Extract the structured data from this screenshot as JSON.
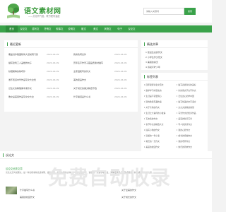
{
  "header": {
    "site_name": "语文素材网",
    "slogan": "——文化有气度，教书更有温度",
    "search_placeholder": "请输入关键词",
    "search_button": "搜索"
  },
  "nav": {
    "items": [
      "首页",
      "议论文",
      "描写文",
      "抒情文",
      "叙事文",
      "说明文",
      "散文",
      "美文",
      "状物文",
      "句子",
      "议论文"
    ]
  },
  "latest": {
    "title": "最近更新",
    "rows": [
      {
        "title": "覆盖创作路面移情大道前雨习篇",
        "date": "2024-04-09",
        "title2": "我喜欢荷念作",
        "date2": "2024-04-09"
      },
      {
        "title": "描写建筑工人盖楼的句子",
        "date": "2024-04-09",
        "title2": "历年名字作景子藏品费素材描写",
        "date2": "2024-04-09"
      },
      {
        "title": "秋晒美等的物呀作",
        "date": "2024-04-09",
        "title2": "全家温暖写的作文",
        "date2": "2024-04-09"
      },
      {
        "title": "谁不知道中华作品写文大全优",
        "date": "2024-04-09",
        "title2": "美的卖品作文",
        "date2": "2024-04-09"
      },
      {
        "title": "记住文的精髓美丰素作文",
        "date": "2024-04-09",
        "title2": "关于成长的美文精选节选",
        "date2": "2024-04-09"
      },
      {
        "title": "散文是美丽作品写文文大全",
        "date": "2024-04-09",
        "title2": "什字播话是什么书",
        "date2": "2024-04-09"
      }
    ]
  },
  "featured": {
    "title": "精选文章",
    "rows": [
      "1 建设生态的作文",
      "2 小学生作文范文",
      "3 美丽的春天",
      "4 诉说叮咛少年"
    ]
  },
  "tags": {
    "title": "标签列表",
    "items": [
      "四年级游泳表文范文",
      "描写春夏秋冬的美好",
      "数学学习好朋友的",
      "好的用文字文字作文",
      "生活是不需要用心",
      "记住这心的学中国",
      "别的教我有趣的事",
      "描写优美的文字语言",
      "关于亲情的作文",
      "文言文说教的美丽",
      "生活之大事件的小故事",
      "写景作文的优秀作品",
      "写友情的作文",
      "美丽的秋天写景",
      "春节作文的精选大全",
      "写人的优秀作文",
      "描写小狗的作文",
      "我的心愿作文",
      "温暖的一件小事",
      "成长的烦恼作文",
      "难忘的一天作文",
      "我的老师作文",
      "美丽的校园作文",
      "快乐的周末作文"
    ]
  },
  "essay_section": {
    "title": "议论文",
    "post_title": "议论文优秀文章",
    "post_summary": "议论文又叫说理文，是一种剖析事物论述事理、发表意见、提出主张的文体。作者通过摆事实、讲道理、辨是非等方法，来确定其观点正确或错误，树立或否定某种主张。",
    "posts": [
      {
        "title": "什字描写什么书",
        "title2": "关于爱美的作文"
      },
      {
        "title": "美丽的校园作文",
        "title2": "关于成长的作文"
      }
    ]
  },
  "watermark": "免费自动收录"
}
